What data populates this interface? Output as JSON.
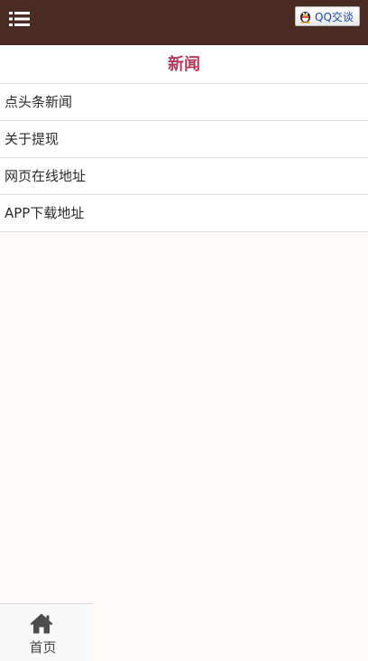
{
  "header": {
    "menu_icon": "list-icon",
    "qq_icon": "qq-penguin-icon",
    "qq_label": "QQ交谈",
    "background_color": "#4a2b23"
  },
  "section": {
    "title": "新闻",
    "title_color": "#b03a5b"
  },
  "news": {
    "items": [
      {
        "label": "点头条新闻"
      },
      {
        "label": "关于提现"
      },
      {
        "label": "网页在线地址"
      },
      {
        "label": "APP下载地址"
      }
    ]
  },
  "footer": {
    "home_icon": "home-icon",
    "home_label": "首页"
  }
}
